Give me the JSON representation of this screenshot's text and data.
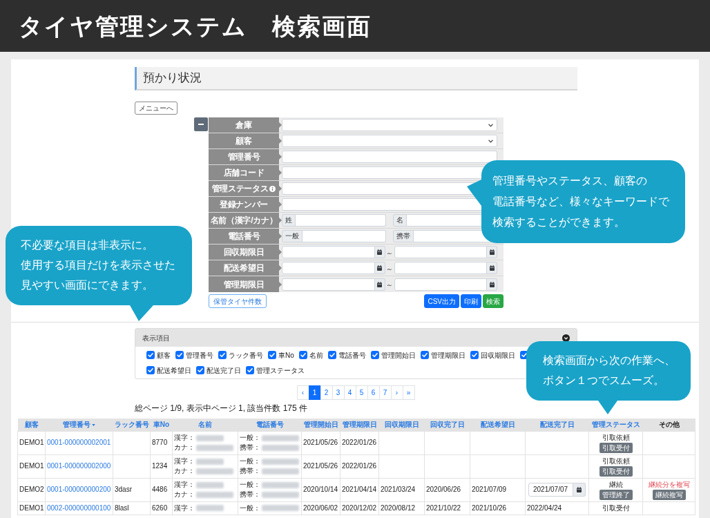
{
  "banner": {
    "title": "タイヤ管理システム　検索画面"
  },
  "section": {
    "title": "預かり状況",
    "menu_button": "メニューへ"
  },
  "search_form": {
    "rows": [
      {
        "label": "倉庫",
        "kind": "select",
        "info": false
      },
      {
        "label": "顧客",
        "kind": "select",
        "info": false
      },
      {
        "label": "管理番号",
        "kind": "text",
        "info": false
      },
      {
        "label": "店舗コード",
        "kind": "text",
        "info": false
      },
      {
        "label": "管理ステータス",
        "kind": "text",
        "info": true
      },
      {
        "label": "登録ナンバー",
        "kind": "text",
        "info": false
      },
      {
        "label": "名前（漢字/カナ）",
        "kind": "pair",
        "info": false,
        "addons": [
          "姓",
          "名"
        ]
      },
      {
        "label": "電話番号",
        "kind": "pair",
        "info": false,
        "addons": [
          "一般",
          "携帯"
        ]
      },
      {
        "label": "回収期限日",
        "kind": "daterange",
        "info": false,
        "separator": "～"
      },
      {
        "label": "配送希望日",
        "kind": "daterange",
        "info": false,
        "separator": "～"
      },
      {
        "label": "管理期限日",
        "kind": "daterange",
        "info": false,
        "separator": "～"
      }
    ],
    "buttons": [
      {
        "label": "保管タイヤ件数",
        "kind": "outline"
      },
      {
        "label": "CSV出力",
        "kind": "primary"
      },
      {
        "label": "印刷",
        "kind": "primary"
      },
      {
        "label": "検索",
        "kind": "success"
      }
    ]
  },
  "display_items": {
    "title": "表示項目",
    "expanded": true,
    "items": [
      {
        "label": "顧客",
        "checked": true
      },
      {
        "label": "管理番号",
        "checked": true
      },
      {
        "label": "ラック番号",
        "checked": true
      },
      {
        "label": "車No",
        "checked": true
      },
      {
        "label": "名前",
        "checked": true
      },
      {
        "label": "電話番号",
        "checked": true
      },
      {
        "label": "管理開始日",
        "checked": true
      },
      {
        "label": "管理期限日",
        "checked": true
      },
      {
        "label": "回収期限日",
        "checked": true
      },
      {
        "checked": true
      },
      {
        "label": "配送希望日",
        "checked": true
      },
      {
        "label": "配送完了日",
        "checked": true
      },
      {
        "label": "管理ステータス",
        "checked": true
      }
    ]
  },
  "pagination": {
    "pages": [
      {
        "label": "‹",
        "selected": false
      },
      {
        "label": "1",
        "selected": true
      },
      {
        "label": "2",
        "selected": false
      },
      {
        "label": "3",
        "selected": false
      },
      {
        "label": "4",
        "selected": false
      },
      {
        "label": "5",
        "selected": false
      },
      {
        "label": "6",
        "selected": false
      },
      {
        "label": "7",
        "selected": false
      },
      {
        "label": "›",
        "selected": false
      },
      {
        "label": "»",
        "selected": false
      }
    ],
    "summary": "総ページ 1/9, 表示中ページ 1, 該当件数 175 件"
  },
  "table": {
    "columns": [
      {
        "label": "顧客",
        "sortable": true,
        "sorted": false
      },
      {
        "label": "管理番号",
        "sortable": true,
        "sorted": true
      },
      {
        "label": "ラック番号",
        "sortable": true,
        "sorted": false
      },
      {
        "label": "車No",
        "sortable": true,
        "sorted": false
      },
      {
        "label": "名前",
        "sortable": true,
        "sorted": false
      },
      {
        "label": "電話番号",
        "sortable": true,
        "sorted": false
      },
      {
        "label": "管理開始日",
        "sortable": true,
        "sorted": false
      },
      {
        "label": "管理期限日",
        "sortable": true,
        "sorted": false
      },
      {
        "label": "回収期限日",
        "sortable": true,
        "sorted": false
      },
      {
        "label": "回収完了日",
        "sortable": true,
        "sorted": false
      },
      {
        "label": "配送希望日",
        "sortable": true,
        "sorted": false
      },
      {
        "label": "配送完了日",
        "sortable": true,
        "sorted": false
      },
      {
        "label": "管理ステータス",
        "sortable": true,
        "sorted": false
      },
      {
        "label": "その他",
        "sortable": false,
        "sorted": false
      }
    ],
    "rows": [
      {
        "customer": "DEMO1",
        "number": "0001-000000002001",
        "car_no": "8770",
        "name_lines": [
          "漢字：",
          "カナ："
        ],
        "phone_lines": [
          "一般：",
          "携帯："
        ],
        "start": "2021/05/26",
        "end": "2022/01/26",
        "status": "引取依頼",
        "status_button": "引取受付"
      },
      {
        "customer": "DEMO1",
        "number": "0001-000000002000",
        "car_no": "1234",
        "name_lines": [
          "漢字：",
          "カナ："
        ],
        "phone_lines": [
          "一般：",
          "携帯："
        ],
        "start": "2021/05/26",
        "end": "2022/01/26",
        "status": "引取依頼",
        "status_button": "引取受付"
      },
      {
        "customer": "DEMO2",
        "number": "0001-000000000200",
        "rack": "3dasr",
        "car_no": "4486",
        "name_lines": [
          "漢字：",
          "カナ："
        ],
        "phone_lines": [
          "一般：",
          "携帯："
        ],
        "start": "2020/10/14",
        "end": "2021/04/14",
        "collect_deadline": "2021/03/24",
        "collect_done": "2020/06/26",
        "delivery_wish": "2021/07/09",
        "delivery_done_input": "2021/07/07",
        "status": "継続",
        "status_button": "管理終了",
        "other_note": "継続分を複写",
        "other_button": "継続複写"
      },
      {
        "customer": "DEMO1",
        "number": "0002-000000000100",
        "rack": "8lasl",
        "car_no": "6260",
        "name_lines": [
          "漢字："
        ],
        "phone_lines": [
          "一般："
        ],
        "start": "2020/06/02",
        "end": "2020/12/02",
        "collect_deadline": "2020/08/12",
        "collect_done": "2021/10/22",
        "delivery_wish": "2021/10/26",
        "delivery_done": "2022/04/24",
        "status": "引取受付"
      }
    ]
  },
  "callouts": [
    {
      "lines": [
        "管理番号やステータス、顧客の",
        "電話番号など、様々なキーワードで",
        "検索することができます。"
      ]
    },
    {
      "lines": [
        "不必要な項目は非表示に。",
        "使用する項目だけを表示させた",
        "見やすい画面にできます。"
      ]
    },
    {
      "lines": [
        "検索画面から次の作業へ、",
        "ボタン１つでスムーズ。"
      ]
    }
  ]
}
